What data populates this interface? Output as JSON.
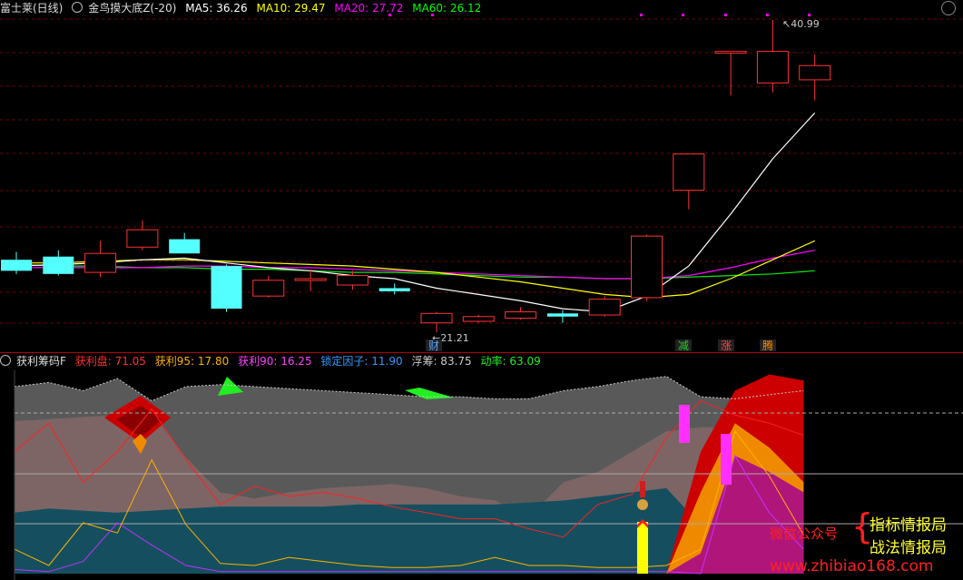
{
  "upper": {
    "title": "富士莱(日线)",
    "indicator": "金鸟摸大底Z(-20)",
    "ma": [
      {
        "label": "MA5: 36.26",
        "color": "#ffffff"
      },
      {
        "label": "MA10: 29.47",
        "color": "#ffff00"
      },
      {
        "label": "MA20: 27.72",
        "color": "#ff00ff"
      },
      {
        "label": "MA60: 26.12",
        "color": "#00ff00"
      }
    ],
    "high_marker": "40.99",
    "low_marker": "21.21",
    "badges": [
      {
        "text": "财",
        "color": "#5aa0ff"
      },
      {
        "text": "减",
        "color": "#22cc22"
      },
      {
        "text": "涨",
        "color": "#ff4444"
      },
      {
        "text": "腾",
        "color": "#ff8800"
      }
    ]
  },
  "lower": {
    "title": "获利筹码F",
    "values": [
      {
        "label": "获利盘: 71.05",
        "color": "#ff3030"
      },
      {
        "label": "获利95: 17.80",
        "color": "#ffb000"
      },
      {
        "label": "获利90: 16.25",
        "color": "#ff40ff"
      },
      {
        "label": "锁定因子: 11.90",
        "color": "#3399ff"
      },
      {
        "label": "浮筹: 83.75",
        "color": "#cccccc"
      },
      {
        "label": "动率: 63.09",
        "color": "#22ee22"
      }
    ]
  },
  "watermark": {
    "left": "微信公众号",
    "line1": "指标情报局",
    "line2": "战法情报局",
    "url": "www.zhibiao168.com"
  },
  "colors": {
    "up": "#ff3232",
    "down": "#54ffff",
    "grid": "#7a0000"
  },
  "chart_data": {
    "type": "candlestick",
    "candles": [
      {
        "o": 25.8,
        "h": 26.3,
        "l": 24.9,
        "c": 25.1
      },
      {
        "o": 26.0,
        "h": 26.4,
        "l": 24.8,
        "c": 24.9
      },
      {
        "o": 25.0,
        "h": 27.0,
        "l": 24.7,
        "c": 26.2
      },
      {
        "o": 26.6,
        "h": 28.3,
        "l": 26.4,
        "c": 27.7
      },
      {
        "o": 27.1,
        "h": 27.5,
        "l": 26.3,
        "c": 26.2
      },
      {
        "o": 25.4,
        "h": 25.5,
        "l": 22.5,
        "c": 22.7
      },
      {
        "o": 23.5,
        "h": 24.8,
        "l": 23.4,
        "c": 24.5
      },
      {
        "o": 24.6,
        "h": 25.2,
        "l": 23.8,
        "c": 24.6
      },
      {
        "o": 24.2,
        "h": 25.1,
        "l": 23.9,
        "c": 24.8
      },
      {
        "o": 24.0,
        "h": 24.3,
        "l": 23.6,
        "c": 23.8
      },
      {
        "o": 21.8,
        "h": 22.5,
        "l": 21.2,
        "c": 22.4
      },
      {
        "o": 21.9,
        "h": 22.3,
        "l": 21.8,
        "c": 22.2
      },
      {
        "o": 22.1,
        "h": 22.8,
        "l": 22.0,
        "c": 22.5
      },
      {
        "o": 22.4,
        "h": 22.6,
        "l": 21.8,
        "c": 22.2
      },
      {
        "o": 22.3,
        "h": 23.5,
        "l": 22.2,
        "c": 23.3
      },
      {
        "o": 23.4,
        "h": 27.4,
        "l": 23.2,
        "c": 27.3
      },
      {
        "o": 30.2,
        "h": 32.5,
        "l": 29.0,
        "c": 32.5
      },
      {
        "o": 39.0,
        "h": 39.0,
        "l": 36.2,
        "c": 39.0
      },
      {
        "o": 37.0,
        "h": 40.99,
        "l": 36.4,
        "c": 39.0
      },
      {
        "o": 37.2,
        "h": 38.8,
        "l": 35.9,
        "c": 38.1
      }
    ],
    "ma5": [
      25.4,
      25.5,
      25.6,
      25.8,
      25.9,
      25.6,
      25.3,
      25.1,
      24.8,
      24.6,
      24.0,
      23.6,
      23.2,
      22.7,
      22.5,
      23.5,
      25.4,
      28.7,
      32.2,
      35.1
    ],
    "ma10": [
      25.6,
      25.6,
      25.7,
      25.8,
      25.8,
      25.7,
      25.6,
      25.5,
      25.4,
      25.2,
      25.0,
      24.7,
      24.4,
      24.0,
      23.6,
      23.4,
      23.6,
      24.6,
      25.8,
      27.0
    ],
    "ma20": [
      25.3,
      25.3,
      25.3,
      25.3,
      25.4,
      25.4,
      25.3,
      25.3,
      25.2,
      25.1,
      25.0,
      24.9,
      24.8,
      24.7,
      24.6,
      24.6,
      24.8,
      25.3,
      25.9,
      26.4
    ],
    "ma60": [
      25.5,
      25.4,
      25.4,
      25.3,
      25.3,
      25.2,
      25.2,
      25.1,
      25.0,
      25.0,
      24.9,
      24.8,
      24.7,
      24.7,
      24.6,
      24.6,
      24.7,
      24.8,
      24.9,
      25.1
    ],
    "lower_series": {
      "gray_top": [
        92,
        94,
        90,
        96,
        85,
        92,
        93,
        92,
        91,
        90,
        89,
        88,
        87,
        87,
        86,
        86,
        90,
        92,
        95,
        97,
        87,
        86,
        88,
        90
      ],
      "rose_top": [
        75,
        76,
        77,
        78,
        79,
        57,
        40,
        37,
        40,
        42,
        43,
        44,
        42,
        38,
        36,
        28,
        45,
        50,
        60,
        70,
        72,
        72,
        75,
        80
      ],
      "teal_top": [
        30,
        32,
        31,
        30,
        31,
        32,
        33,
        33,
        33,
        33,
        34,
        34,
        34,
        34,
        34,
        35,
        36,
        38,
        40,
        42,
        24,
        30,
        28,
        20
      ],
      "pink_top": [
        0,
        0,
        0,
        0,
        0,
        0,
        0,
        0,
        0,
        0,
        0,
        0,
        0,
        0,
        0,
        0,
        0,
        0,
        0,
        0,
        10,
        58,
        50,
        40
      ],
      "orange_top": [
        0,
        0,
        0,
        0,
        0,
        0,
        0,
        0,
        0,
        0,
        0,
        0,
        0,
        0,
        0,
        0,
        0,
        0,
        0,
        0,
        40,
        74,
        62,
        45
      ],
      "red_top": [
        0,
        0,
        0,
        0,
        0,
        0,
        0,
        0,
        0,
        0,
        0,
        0,
        0,
        0,
        0,
        0,
        0,
        0,
        0,
        0,
        60,
        90,
        98,
        95
      ],
      "red_line": [
        60,
        74,
        45,
        60,
        81,
        56,
        34,
        43,
        38,
        40,
        37,
        33,
        30,
        27,
        27,
        22,
        18,
        34,
        39,
        67,
        85,
        78,
        74,
        68
      ],
      "orange_line": [
        12,
        4,
        25,
        20,
        56,
        24,
        5,
        4,
        8,
        6,
        4,
        3,
        3,
        4,
        8,
        4,
        4,
        3,
        3,
        4,
        12,
        70,
        48,
        19
      ],
      "purple_line": [
        2,
        1,
        6,
        25,
        14,
        4,
        1,
        1,
        1,
        1,
        1,
        1,
        1,
        1,
        1,
        1,
        1,
        1,
        1,
        1,
        0,
        58,
        30,
        12
      ]
    }
  }
}
